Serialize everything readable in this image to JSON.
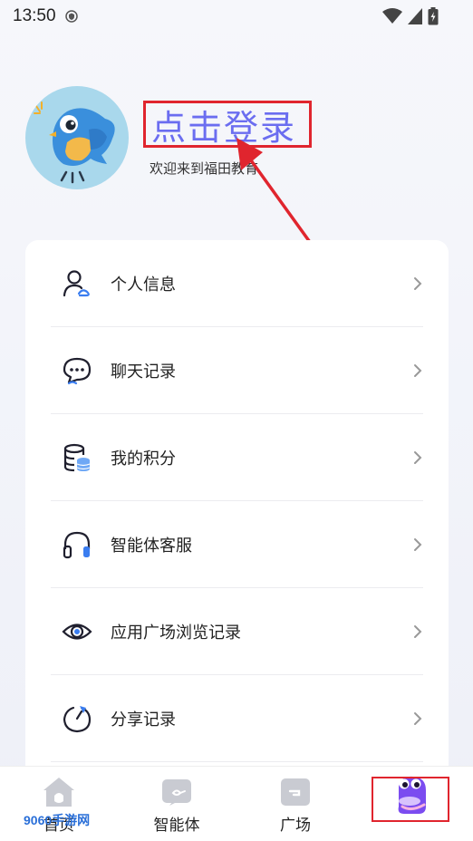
{
  "status_bar": {
    "time": "13:50"
  },
  "profile": {
    "login_label": "点击登录",
    "welcome_text": "欢迎来到福田教育"
  },
  "menu": [
    {
      "label": "个人信息",
      "icon": "person-icon"
    },
    {
      "label": "聊天记录",
      "icon": "chat-icon"
    },
    {
      "label": "我的积分",
      "icon": "database-icon"
    },
    {
      "label": "智能体客服",
      "icon": "headset-icon"
    },
    {
      "label": "应用广场浏览记录",
      "icon": "eye-icon"
    },
    {
      "label": "分享记录",
      "icon": "share-icon"
    }
  ],
  "bottom_nav": [
    {
      "label": "首页",
      "icon": "home-icon"
    },
    {
      "label": "智能体",
      "icon": "agent-icon"
    },
    {
      "label": "广场",
      "icon": "plaza-icon"
    },
    {
      "label": "",
      "icon": "mascot-icon"
    }
  ],
  "watermark": "9060手游网",
  "colors": {
    "accent": "#6b6df0",
    "annotation": "#e0252e"
  }
}
